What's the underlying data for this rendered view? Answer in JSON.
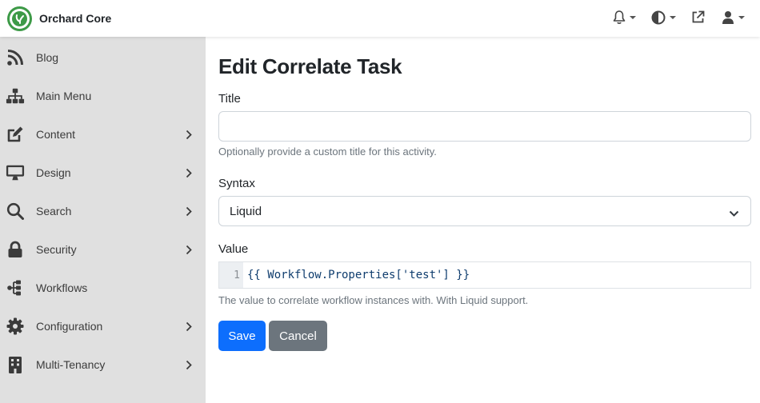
{
  "app": {
    "name": "Orchard Core"
  },
  "colors": {
    "brand": "#3d9a47",
    "primary": "#0d6efd",
    "secondary": "#6c757d",
    "sidebar_bg": "#e0e0e0"
  },
  "topbar": {
    "icons": [
      "bell-icon",
      "contrast-icon",
      "external-link-icon",
      "user-icon"
    ]
  },
  "sidebar": {
    "items": [
      {
        "label": "Blog",
        "icon": "rss-icon",
        "has_children": false
      },
      {
        "label": "Main Menu",
        "icon": "sitemap-icon",
        "has_children": false
      },
      {
        "label": "Content",
        "icon": "edit-icon",
        "has_children": true
      },
      {
        "label": "Design",
        "icon": "desktop-icon",
        "has_children": true
      },
      {
        "label": "Search",
        "icon": "search-icon",
        "has_children": true
      },
      {
        "label": "Security",
        "icon": "lock-icon",
        "has_children": true
      },
      {
        "label": "Workflows",
        "icon": "workflow-icon",
        "has_children": false
      },
      {
        "label": "Configuration",
        "icon": "gear-icon",
        "has_children": true
      },
      {
        "label": "Multi-Tenancy",
        "icon": "building-icon",
        "has_children": true
      }
    ]
  },
  "form": {
    "page_title": "Edit Correlate Task",
    "title_label": "Title",
    "title_value": "",
    "title_help": "Optionally provide a custom title for this activity.",
    "syntax_label": "Syntax",
    "syntax_value": "Liquid",
    "value_label": "Value",
    "value_line_number": "1",
    "value_code": "{{ Workflow.Properties['test'] }}",
    "value_help": "The value to correlate workflow instances with. With Liquid support.",
    "save_label": "Save",
    "cancel_label": "Cancel"
  }
}
